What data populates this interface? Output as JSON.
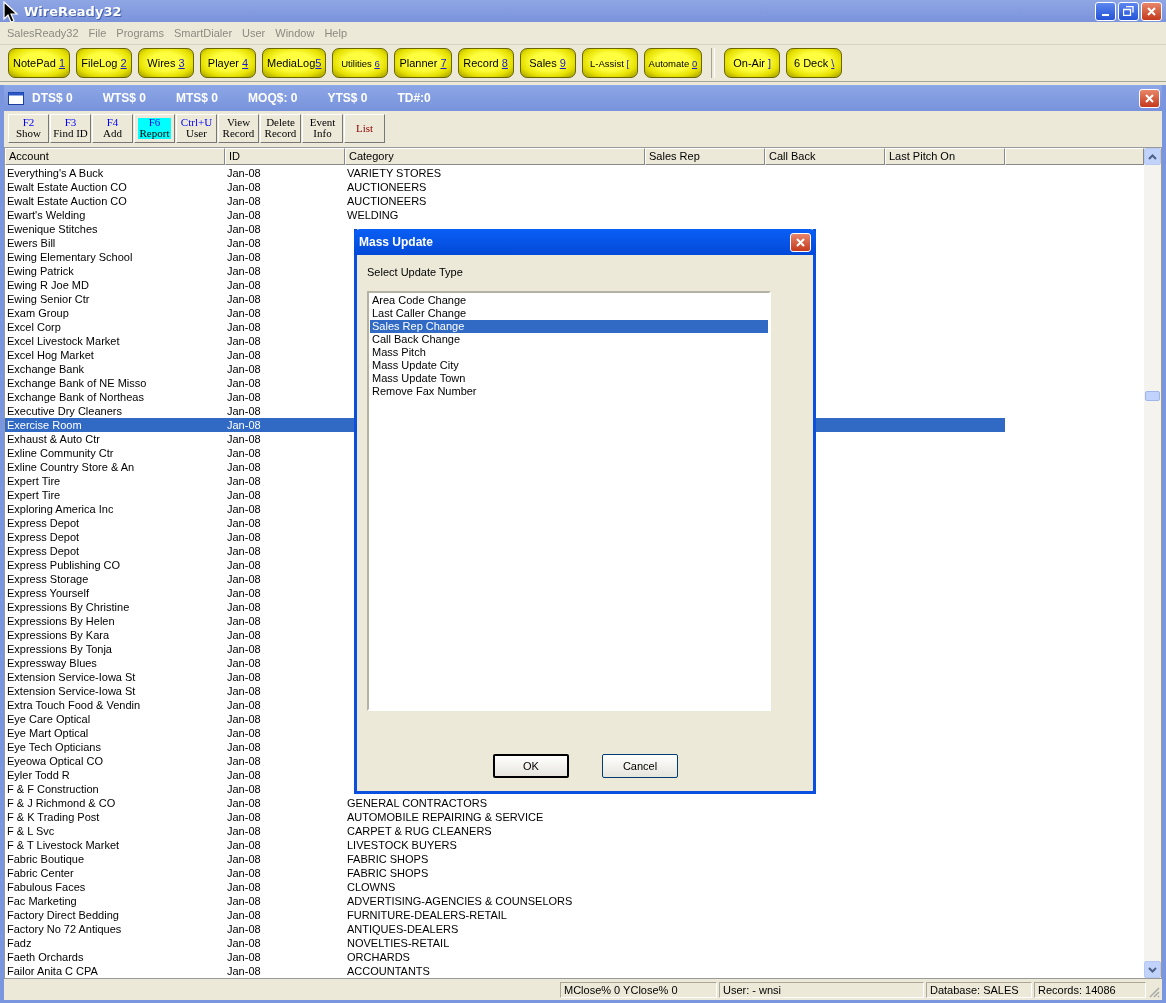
{
  "window": {
    "title": "WireReady32"
  },
  "menu": [
    "SalesReady32",
    "File",
    "Programs",
    "SmartDialer",
    "User",
    "Window",
    "Help"
  ],
  "launcher_groups": [
    {
      "buttons": [
        {
          "label": "NotePad",
          "key": "1",
          "spaced": true
        },
        {
          "label": "FileLog",
          "key": "2",
          "spaced": true
        },
        {
          "label": "Wires",
          "key": "3",
          "spaced": true
        },
        {
          "label": "Player",
          "key": "4",
          "spaced": true
        },
        {
          "label": "MediaLog",
          "key": "5",
          "spaced": false
        },
        {
          "label": "Utilities",
          "key": "6",
          "spaced": true
        },
        {
          "label": "Planner",
          "key": "7",
          "spaced": true
        },
        {
          "label": "Record",
          "key": "8",
          "spaced": true
        },
        {
          "label": "Sales",
          "key": "9",
          "spaced": true
        },
        {
          "label": "L-Assist",
          "key": "[",
          "spaced": true
        },
        {
          "label": "Automate",
          "key": "0",
          "spaced": true
        }
      ]
    },
    {
      "buttons": [
        {
          "label": "On-Air",
          "key": "]",
          "spaced": true
        },
        {
          "label": "6 Deck",
          "key": "\\",
          "spaced": true
        }
      ]
    }
  ],
  "sales_window": {
    "stats": [
      "DTS$ 0",
      "WTS$ 0",
      "MTS$ 0",
      "MOQ$: 0",
      "YTS$ 0",
      "TD#:0"
    ]
  },
  "toolbar": [
    {
      "kind": "hotkey",
      "top": "F2",
      "bottom": "Show",
      "selected": false
    },
    {
      "kind": "hotkey",
      "top": "F3",
      "bottom": "Find ID",
      "selected": false
    },
    {
      "kind": "hotkey",
      "top": "F4",
      "bottom": "Add",
      "selected": false
    },
    {
      "kind": "hotkey",
      "top": "F6",
      "bottom": "Report",
      "selected": true
    },
    {
      "kind": "hotkey",
      "top": "Ctrl+U",
      "bottom": "User",
      "selected": false
    },
    {
      "kind": "plain",
      "top": "View",
      "bottom": "Record",
      "selected": false
    },
    {
      "kind": "plain",
      "top": "Delete",
      "bottom": "Record",
      "selected": false
    },
    {
      "kind": "plain",
      "top": "Event",
      "bottom": "Info",
      "selected": false
    },
    {
      "kind": "single",
      "top": "List",
      "selected": false
    }
  ],
  "table": {
    "columns": [
      "Account",
      "ID",
      "Category",
      "Sales Rep",
      "Call Back",
      "Last Pitch On"
    ],
    "rows": [
      {
        "account": "Everything's A Buck",
        "id": "Jan-08",
        "category": "VARIETY STORES",
        "selected": false
      },
      {
        "account": "Ewalt Estate Auction CO",
        "id": "Jan-08",
        "category": "AUCTIONEERS",
        "selected": false
      },
      {
        "account": "Ewalt Estate Auction CO",
        "id": "Jan-08",
        "category": "AUCTIONEERS",
        "selected": false
      },
      {
        "account": "Ewart's Welding",
        "id": "Jan-08",
        "category": "WELDING",
        "selected": false
      },
      {
        "account": "Ewenique Stitches",
        "id": "Jan-08",
        "selected": false
      },
      {
        "account": "Ewers Bill",
        "id": "Jan-08",
        "selected": false
      },
      {
        "account": "Ewing Elementary School",
        "id": "Jan-08",
        "selected": false
      },
      {
        "account": "Ewing Patrick",
        "id": "Jan-08",
        "selected": false
      },
      {
        "account": "Ewing R Joe MD",
        "id": "Jan-08",
        "selected": false
      },
      {
        "account": "Ewing Senior Ctr",
        "id": "Jan-08",
        "selected": false
      },
      {
        "account": "Exam Group",
        "id": "Jan-08",
        "selected": false
      },
      {
        "account": "Excel Corp",
        "id": "Jan-08",
        "selected": false
      },
      {
        "account": "Excel Livestock Market",
        "id": "Jan-08",
        "selected": false
      },
      {
        "account": "Excel Hog Market",
        "id": "Jan-08",
        "selected": false
      },
      {
        "account": "Exchange Bank",
        "id": "Jan-08",
        "selected": false
      },
      {
        "account": "Exchange Bank of NE Misso",
        "id": "Jan-08",
        "selected": false
      },
      {
        "account": "Exchange Bank of Northeas",
        "id": "Jan-08",
        "selected": false
      },
      {
        "account": "Executive Dry Cleaners",
        "id": "Jan-08",
        "selected": false
      },
      {
        "account": "Exercise Room",
        "id": "Jan-08",
        "selected": true
      },
      {
        "account": "Exhaust & Auto Ctr",
        "id": "Jan-08",
        "selected": false
      },
      {
        "account": "Exline Community Ctr",
        "id": "Jan-08",
        "selected": false
      },
      {
        "account": "Exline Country Store & An",
        "id": "Jan-08",
        "selected": false
      },
      {
        "account": "Expert Tire",
        "id": "Jan-08",
        "selected": false
      },
      {
        "account": "Expert Tire",
        "id": "Jan-08",
        "selected": false
      },
      {
        "account": "Exploring America Inc",
        "id": "Jan-08",
        "selected": false
      },
      {
        "account": "Express Depot",
        "id": "Jan-08",
        "selected": false
      },
      {
        "account": "Express Depot",
        "id": "Jan-08",
        "selected": false
      },
      {
        "account": "Express Depot",
        "id": "Jan-08",
        "selected": false
      },
      {
        "account": "Express Publishing CO",
        "id": "Jan-08",
        "selected": false
      },
      {
        "account": "Express Storage",
        "id": "Jan-08",
        "selected": false
      },
      {
        "account": "Express Yourself",
        "id": "Jan-08",
        "selected": false
      },
      {
        "account": "Expressions By Christine",
        "id": "Jan-08",
        "selected": false
      },
      {
        "account": "Expressions By Helen",
        "id": "Jan-08",
        "selected": false
      },
      {
        "account": "Expressions By Kara",
        "id": "Jan-08",
        "selected": false
      },
      {
        "account": "Expressions By Tonja",
        "id": "Jan-08",
        "selected": false
      },
      {
        "account": "Expressway Blues",
        "id": "Jan-08",
        "selected": false
      },
      {
        "account": "Extension Service-Iowa St",
        "id": "Jan-08",
        "selected": false
      },
      {
        "account": "Extension Service-Iowa St",
        "id": "Jan-08",
        "selected": false
      },
      {
        "account": "Extra Touch Food & Vendin",
        "id": "Jan-08",
        "selected": false
      },
      {
        "account": "Eye Care Optical",
        "id": "Jan-08",
        "selected": false
      },
      {
        "account": "Eye Mart Optical",
        "id": "Jan-08",
        "selected": false
      },
      {
        "account": "Eye Tech Opticians",
        "id": "Jan-08",
        "selected": false
      },
      {
        "account": "Eyeowa Optical CO",
        "id": "Jan-08",
        "selected": false
      },
      {
        "account": "Eyler Todd R",
        "id": "Jan-08",
        "selected": false
      },
      {
        "account": "F & F Construction",
        "id": "Jan-08",
        "selected": false
      },
      {
        "account": "F & J Richmond & CO",
        "id": "Jan-08",
        "category": "GENERAL CONTRACTORS",
        "selected": false
      },
      {
        "account": "F & K Trading Post",
        "id": "Jan-08",
        "category": "AUTOMOBILE REPAIRING & SERVICE",
        "selected": false
      },
      {
        "account": "F & L Svc",
        "id": "Jan-08",
        "category": "CARPET & RUG CLEANERS",
        "selected": false
      },
      {
        "account": "F & T Livestock Market",
        "id": "Jan-08",
        "category": "LIVESTOCK BUYERS",
        "selected": false
      },
      {
        "account": "Fabric Boutique",
        "id": "Jan-08",
        "category": "FABRIC SHOPS",
        "selected": false
      },
      {
        "account": "Fabric Center",
        "id": "Jan-08",
        "category": "FABRIC SHOPS",
        "selected": false
      },
      {
        "account": "Fabulous Faces",
        "id": "Jan-08",
        "category": "CLOWNS",
        "selected": false
      },
      {
        "account": "Fac Marketing",
        "id": "Jan-08",
        "category": "ADVERTISING-AGENCIES & COUNSELORS",
        "selected": false
      },
      {
        "account": "Factory Direct Bedding",
        "id": "Jan-08",
        "category": "FURNITURE-DEALERS-RETAIL",
        "selected": false
      },
      {
        "account": "Factory No 72 Antiques",
        "id": "Jan-08",
        "category": "ANTIQUES-DEALERS",
        "selected": false
      },
      {
        "account": "Fadz",
        "id": "Jan-08",
        "category": "NOVELTIES-RETAIL",
        "selected": false
      },
      {
        "account": "Faeth Orchards",
        "id": "Jan-08",
        "category": "ORCHARDS",
        "selected": false
      },
      {
        "account": "Failor Anita C CPA",
        "id": "Jan-08",
        "category": "ACCOUNTANTS",
        "selected": false
      }
    ]
  },
  "dialog": {
    "title": "Mass Update",
    "label": "Select Update Type",
    "options": [
      {
        "label": "Area Code Change",
        "selected": false
      },
      {
        "label": "Last Caller Change",
        "selected": false
      },
      {
        "label": "Sales Rep Change",
        "selected": true
      },
      {
        "label": "Call Back Change",
        "selected": false
      },
      {
        "label": "Mass Pitch",
        "selected": false
      },
      {
        "label": "Mass Update City",
        "selected": false
      },
      {
        "label": "Mass Update Town",
        "selected": false
      },
      {
        "label": "Remove Fax Number",
        "selected": false
      }
    ],
    "buttons": [
      "OK",
      "Cancel"
    ]
  },
  "status_bar": [
    "MClose% 0 YClose% 0",
    "User:  - wnsi",
    "Database: SALES",
    "Records: 14086"
  ]
}
